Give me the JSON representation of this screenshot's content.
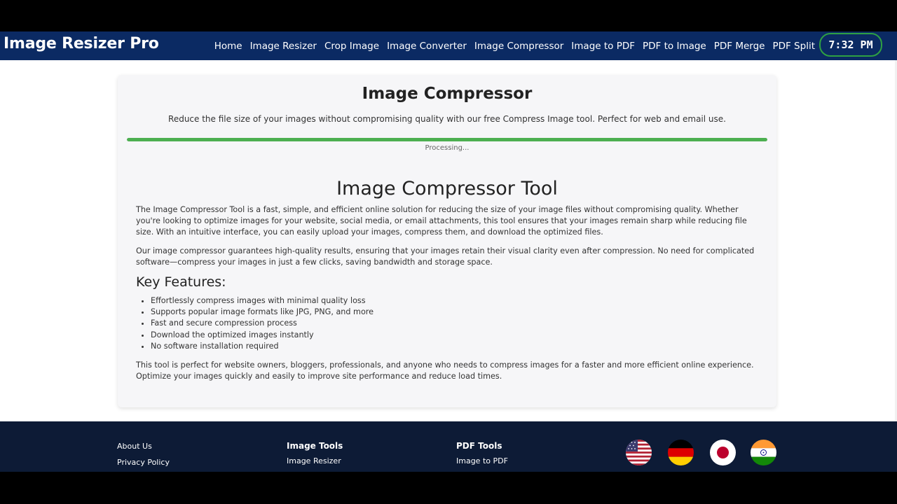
{
  "brand": "Image Resizer Pro",
  "nav": [
    "Home",
    "Image Resizer",
    "Crop Image",
    "Image Converter",
    "Image Compressor",
    "Image to PDF",
    "PDF to Image",
    "PDF Merge",
    "PDF Split"
  ],
  "clock": "7:32 PM",
  "card": {
    "title": "Image Compressor",
    "subtitle": "Reduce the file size of your images without compromising quality with our free Compress Image tool. Perfect for web and email use.",
    "progress_percent": 100,
    "progress_text": "Processing..."
  },
  "content": {
    "title": "Image Compressor Tool",
    "p1": "The Image Compressor Tool is a fast, simple, and efficient online solution for reducing the size of your image files without compromising quality. Whether you're looking to optimize images for your website, social media, or email attachments, this tool ensures that your images remain sharp while reducing file size. With an intuitive interface, you can easily upload your images, compress them, and download the optimized files.",
    "p2": "Our image compressor guarantees high-quality results, ensuring that your images retain their visual clarity even after compression. No need for complicated software—compress your images in just a few clicks, saving bandwidth and storage space.",
    "features_title": "Key Features:",
    "features": [
      "Effortlessly compress images with minimal quality loss",
      "Supports popular image formats like JPG, PNG, and more",
      "Fast and secure compression process",
      "Download the optimized images instantly",
      "No software installation required"
    ],
    "p3": "This tool is perfect for website owners, bloggers, professionals, and anyone who needs to compress images for a faster and more efficient online experience. Optimize your images quickly and easily to improve site performance and reduce load times."
  },
  "footer": {
    "about": "About Us",
    "privacy": "Privacy Policy",
    "image_tools_head": "Image Tools",
    "image_tools_link": "Image Resizer",
    "pdf_tools_head": "PDF Tools",
    "pdf_tools_link": "Image to PDF",
    "flags": [
      "us-flag-icon",
      "germany-flag-icon",
      "japan-flag-icon",
      "india-flag-icon"
    ]
  },
  "colors": {
    "navbar": "#0b2a63",
    "footer": "#0d1b36",
    "progress": "#4caf50",
    "clock_border": "#2ea043"
  }
}
